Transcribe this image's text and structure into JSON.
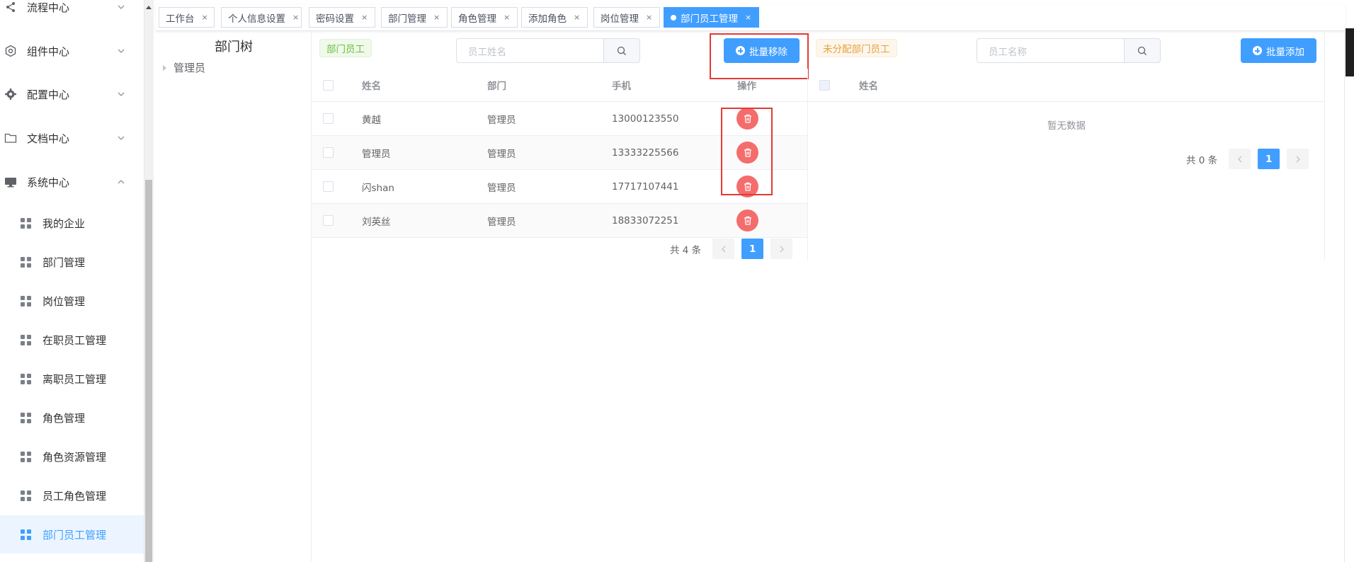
{
  "sidebar": {
    "menus": [
      {
        "label": "流程中心",
        "icon": "share-icon",
        "expanded": false
      },
      {
        "label": "组件中心",
        "icon": "component-icon",
        "expanded": false
      },
      {
        "label": "配置中心",
        "icon": "gear-icon",
        "expanded": false
      },
      {
        "label": "文档中心",
        "icon": "folder-icon",
        "expanded": false
      },
      {
        "label": "系统中心",
        "icon": "monitor-icon",
        "expanded": true
      }
    ],
    "sub_items": [
      {
        "label": "我的企业",
        "active": false
      },
      {
        "label": "部门管理",
        "active": false
      },
      {
        "label": "岗位管理",
        "active": false
      },
      {
        "label": "在职员工管理",
        "active": false
      },
      {
        "label": "离职员工管理",
        "active": false
      },
      {
        "label": "角色管理",
        "active": false
      },
      {
        "label": "角色资源管理",
        "active": false
      },
      {
        "label": "员工角色管理",
        "active": false
      },
      {
        "label": "部门员工管理",
        "active": true
      }
    ]
  },
  "tabs": [
    {
      "label": "工作台",
      "close": "×"
    },
    {
      "label": "个人信息设置",
      "close": "×"
    },
    {
      "label": "密码设置",
      "close": "×"
    },
    {
      "label": "部门管理",
      "close": "×"
    },
    {
      "label": "角色管理",
      "close": "×"
    },
    {
      "label": "添加角色",
      "close": "×"
    },
    {
      "label": "岗位管理",
      "close": "×"
    },
    {
      "label": "部门员工管理",
      "close": "×",
      "active": true
    }
  ],
  "tree": {
    "title": "部门树",
    "nodes": [
      "管理员"
    ]
  },
  "dept_panel": {
    "tag": "部门员工",
    "search_placeholder": "员工姓名",
    "batch_button": "批量移除",
    "columns": [
      "姓名",
      "部门",
      "手机",
      "操作"
    ],
    "rows": [
      {
        "name": "黄越",
        "dept": "管理员",
        "phone": "13000123550"
      },
      {
        "name": "管理员",
        "dept": "管理员",
        "phone": "13333225566"
      },
      {
        "name": "闪shan",
        "dept": "管理员",
        "phone": "17717107441"
      },
      {
        "name": "刘英丝",
        "dept": "管理员",
        "phone": "18833072251"
      }
    ],
    "total": "共 4 条",
    "page": "1"
  },
  "unassigned_panel": {
    "tag": "未分配部门员工",
    "search_placeholder": "员工名称",
    "batch_button": "批量添加",
    "columns": [
      "姓名"
    ],
    "empty_text": "暂无数据",
    "total": "共 0 条",
    "page": "1"
  },
  "colors": {
    "primary": "#409eff",
    "danger": "#f56c6c",
    "success_tag": "#67c23a",
    "warning_tag": "#e6a23c",
    "highlight_box": "#e53935"
  }
}
